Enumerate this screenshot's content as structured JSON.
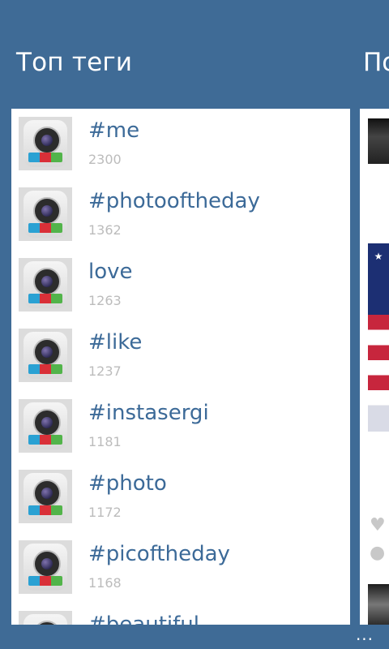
{
  "header": {
    "title": "Топ теги",
    "next_title": "По"
  },
  "tags": [
    {
      "name": "#me",
      "count": "2300"
    },
    {
      "name": "#photooftheday",
      "count": "1362"
    },
    {
      "name": "love",
      "count": "1263"
    },
    {
      "name": "#like",
      "count": "1237"
    },
    {
      "name": "#instasergi",
      "count": "1181"
    },
    {
      "name": "#photo",
      "count": "1172"
    },
    {
      "name": "#picoftheday",
      "count": "1168"
    },
    {
      "name": "#beautiful",
      "count": ""
    }
  ],
  "icons": {
    "tag_icon": "camera-app-icon",
    "like_icon": "heart-icon",
    "comment_icon": "comment-icon",
    "more_icon": "ellipsis-icon"
  },
  "right_panel": {
    "flag_stars": "★"
  },
  "app_bar": {
    "more_label": "..."
  },
  "colors": {
    "background": "#3f6b96",
    "tag_text": "#3c6a98",
    "count_text": "#bcbcbc"
  }
}
